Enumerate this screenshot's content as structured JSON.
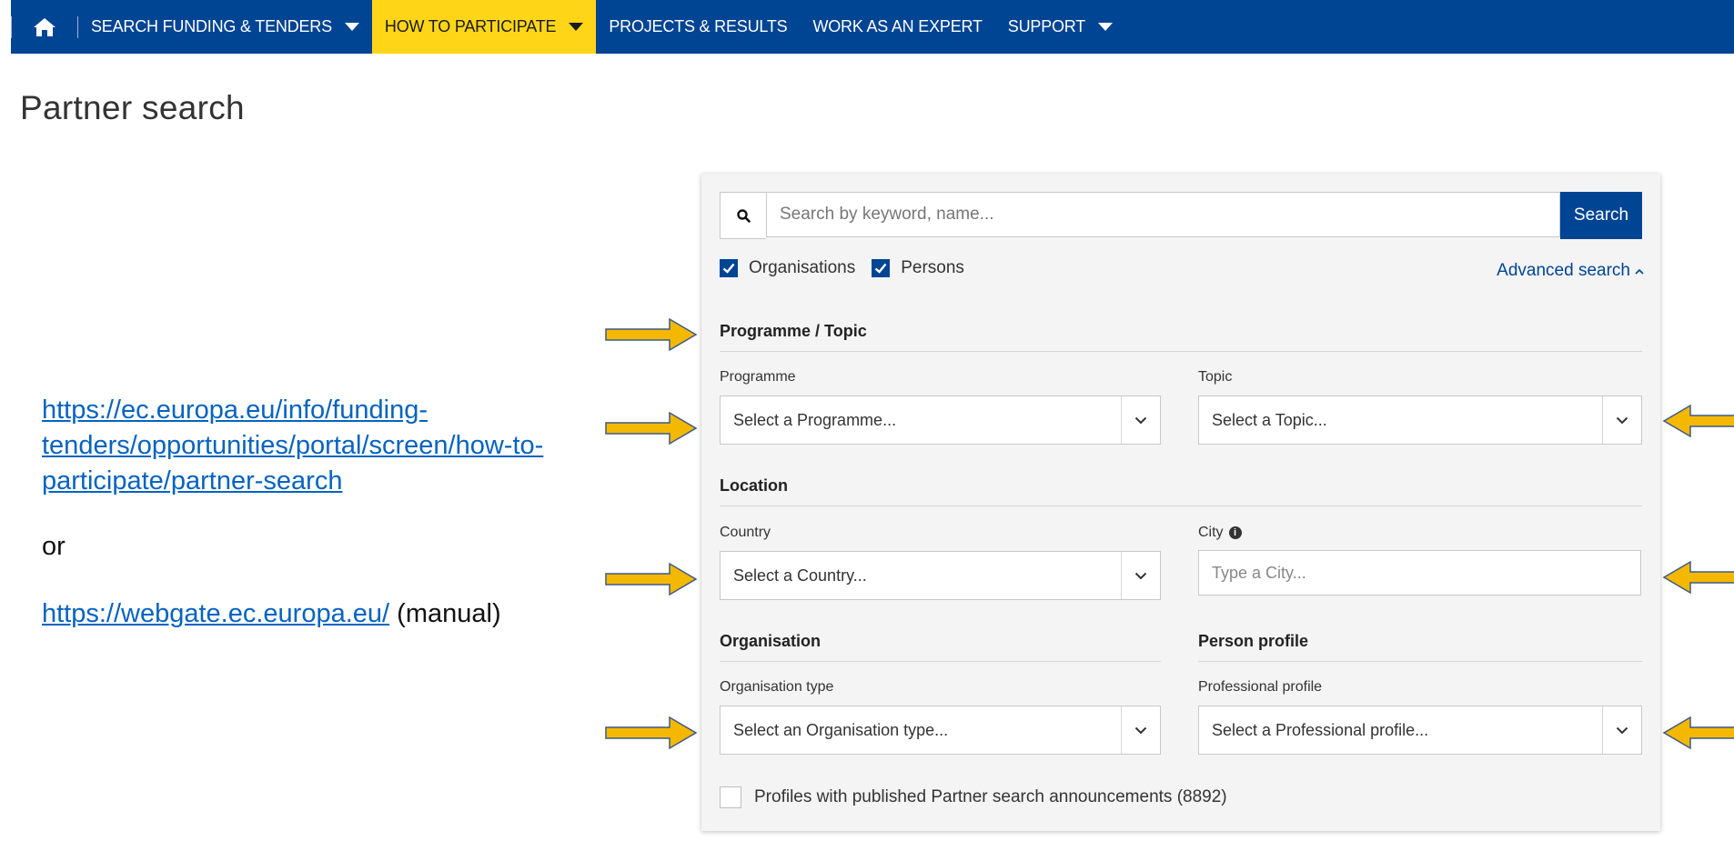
{
  "nav": {
    "home_icon": "home-icon",
    "items": [
      {
        "label": "SEARCH FUNDING & TENDERS",
        "dropdown": true,
        "active": false
      },
      {
        "label": "HOW TO PARTICIPATE",
        "dropdown": true,
        "active": true
      },
      {
        "label": "PROJECTS & RESULTS",
        "dropdown": false,
        "active": false
      },
      {
        "label": "WORK AS AN EXPERT",
        "dropdown": false,
        "active": false
      },
      {
        "label": "SUPPORT",
        "dropdown": true,
        "active": false
      }
    ]
  },
  "page": {
    "title": "Partner search"
  },
  "left": {
    "link_line1": "https://ec.europa.eu/info/funding-",
    "link_line2": "tenders/opportunities/portal/screen/how-to-",
    "link_line3": "participate/partner-search",
    "or": "or",
    "webgate_link": "https://webgate.ec.europa.eu/",
    "webgate_suffix": " (manual)"
  },
  "search": {
    "placeholder": "Search by keyword, name...",
    "button": "Search",
    "icon": "search-icon",
    "organisations_label": "Organisations",
    "persons_label": "Persons",
    "advanced_label": "Advanced search"
  },
  "programme_topic": {
    "title": "Programme / Topic",
    "programme_label": "Programme",
    "programme_value": "Select a Programme...",
    "topic_label": "Topic",
    "topic_value": "Select a Topic..."
  },
  "location": {
    "title": "Location",
    "country_label": "Country",
    "country_value": "Select a Country...",
    "city_label": "City",
    "city_placeholder": "Type a City..."
  },
  "organisation": {
    "title": "Organisation",
    "type_label": "Organisation type",
    "type_value": "Select an Organisation type..."
  },
  "person": {
    "title": "Person profile",
    "profile_label": "Professional profile",
    "profile_value": "Select a Professional profile..."
  },
  "announcements_label": "Profiles with published Partner search announcements (8892)",
  "colors": {
    "nav_bg": "#004494",
    "active_tab": "#ffd617",
    "arrow": "#f5b800",
    "link": "#0563c1"
  }
}
